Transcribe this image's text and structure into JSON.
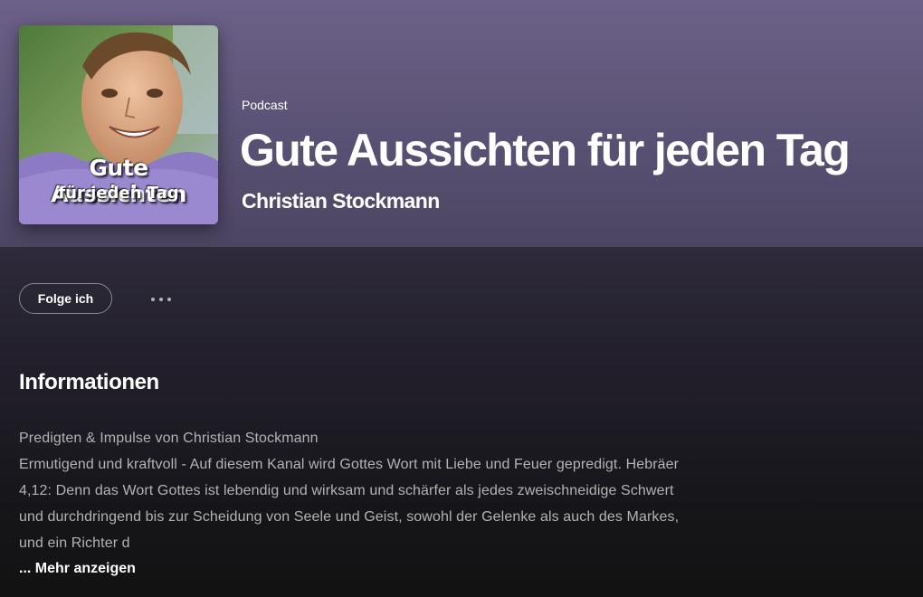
{
  "podcast": {
    "type_label": "Podcast",
    "title": "Gute Aussichten für jeden Tag",
    "author": "Christian Stockmann",
    "cover": {
      "line1": "Gute Aussichten",
      "line2": "für jeden Tag"
    }
  },
  "actions": {
    "follow_label": "Folge ich",
    "more_icon": "more-horizontal-icon"
  },
  "info": {
    "heading": "Informationen",
    "description_lines": [
      "Predigten & Impulse von Christian Stockmann",
      "Ermutigend und kraftvoll - Auf diesem Kanal wird Gottes Wort mit Liebe und Feuer gepredigt. Hebräer",
      "4,12: Denn das Wort Gottes ist lebendig und wirksam und schärfer als jedes zweischneidige Schwert",
      "und durchdringend bis zur Scheidung von Seele und Geist, sowohl der Gelenke als auch des Markes,",
      "und ein Richter d"
    ],
    "show_more_label": "... Mehr anzeigen"
  },
  "colors": {
    "header_top": "#6c6188",
    "header_bottom": "#4c4562",
    "background": "#121212",
    "text_primary": "#ffffff",
    "text_secondary": "#b3b3b3"
  }
}
